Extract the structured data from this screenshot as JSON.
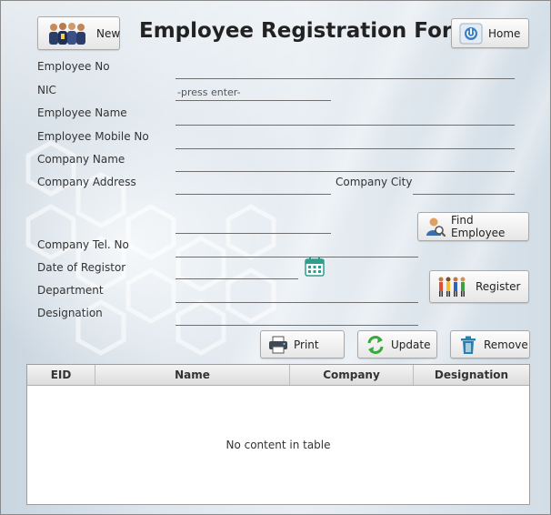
{
  "form": {
    "title": "Employee Registration Form"
  },
  "buttons": {
    "new": "New",
    "home": "Home",
    "find_employee": "Find Employee",
    "register": "Register",
    "print": "Print",
    "update": "Update",
    "remove": "Remove"
  },
  "labels": {
    "employee_no": "Employee No",
    "nic": "NIC",
    "employee_name": "Employee Name",
    "employee_mobile_no": "Employee Mobile No",
    "company_name": "Company Name",
    "company_address": "Company Address",
    "company_city": "Company City",
    "company_tel_no": "Company Tel. No",
    "date_of_registor": "Date of Registor",
    "department": "Department",
    "designation": "Designation"
  },
  "fields": {
    "employee_no": "",
    "nic_placeholder": "-press enter-",
    "employee_name": "",
    "employee_mobile_no": "",
    "company_name": "",
    "company_address": "",
    "company_city": "",
    "company_tel_no": "",
    "date_of_registor": "",
    "department": "",
    "designation": ""
  },
  "table": {
    "columns": [
      "EID",
      "Name",
      "Company",
      "Designation"
    ],
    "rows": [],
    "empty_message": "No content in table"
  },
  "icons": {
    "new": "people-group-icon",
    "home": "power-icon",
    "find_employee": "user-search-icon",
    "register": "people-register-icon",
    "print": "printer-icon",
    "update": "refresh-icon",
    "remove": "trash-icon",
    "calendar": "calendar-icon"
  },
  "colors": {
    "background": "#dfe7ee",
    "calendar": "#2e9e8e",
    "update_icon": "#3aa83a",
    "remove_icon": "#2a7fb0"
  }
}
